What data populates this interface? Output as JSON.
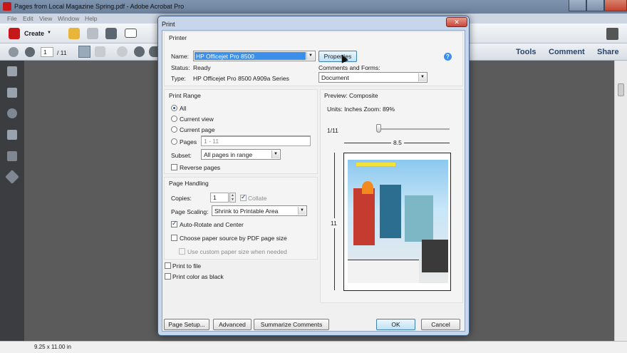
{
  "app": {
    "title": "Pages from Local Magazine Spring.pdf - Adobe Acrobat Pro",
    "menu": [
      "File",
      "Edit",
      "View",
      "Window",
      "Help"
    ],
    "toolbar": {
      "create_label": "Create",
      "page_current": "1",
      "page_total": "/ 11"
    },
    "right_tabs": [
      "Tools",
      "Comment",
      "Share"
    ],
    "status_size": "9.25 x 11.00 in"
  },
  "print_dialog": {
    "title": "Print",
    "printer": {
      "section": "Printer",
      "name_label": "Name:",
      "name_value": "HP Officejet Pro 8500",
      "status_label": "Status:",
      "status_value": "Ready",
      "type_label": "Type:",
      "type_value": "HP Officejet Pro 8500 A909a Series",
      "properties_label": "Properties",
      "comments_forms_label": "Comments and Forms:",
      "comments_forms_value": "Document",
      "help_glyph": "?"
    },
    "print_range": {
      "section": "Print Range",
      "all": "All",
      "current_view": "Current view",
      "current_page": "Current page",
      "pages": "Pages",
      "pages_value": "1 - 11",
      "subset_label": "Subset:",
      "subset_value": "All pages in range",
      "reverse": "Reverse pages"
    },
    "page_handling": {
      "section": "Page Handling",
      "copies_label": "Copies:",
      "copies_value": "1",
      "collate": "Collate",
      "scaling_label": "Page Scaling:",
      "scaling_value": "Shrink to Printable Area",
      "auto_rotate": "Auto-Rotate and Center",
      "paper_source": "Choose paper source by PDF page size",
      "custom_paper": "Use custom paper size when needed"
    },
    "print_to_file": "Print to file",
    "print_color_black": "Print color as black",
    "preview": {
      "section": "Preview: Composite",
      "units": "Units: Inches Zoom:  89%",
      "page_indicator": "1/11",
      "width": "8.5",
      "height": "11"
    },
    "buttons": {
      "page_setup": "Page Setup...",
      "advanced": "Advanced",
      "summarize": "Summarize Comments",
      "ok": "OK",
      "cancel": "Cancel",
      "close": "✕"
    },
    "colors": {
      "title_bar": "#c7d6ea",
      "close_button": "#c6463a",
      "highlight": "#3b8fe8"
    }
  }
}
